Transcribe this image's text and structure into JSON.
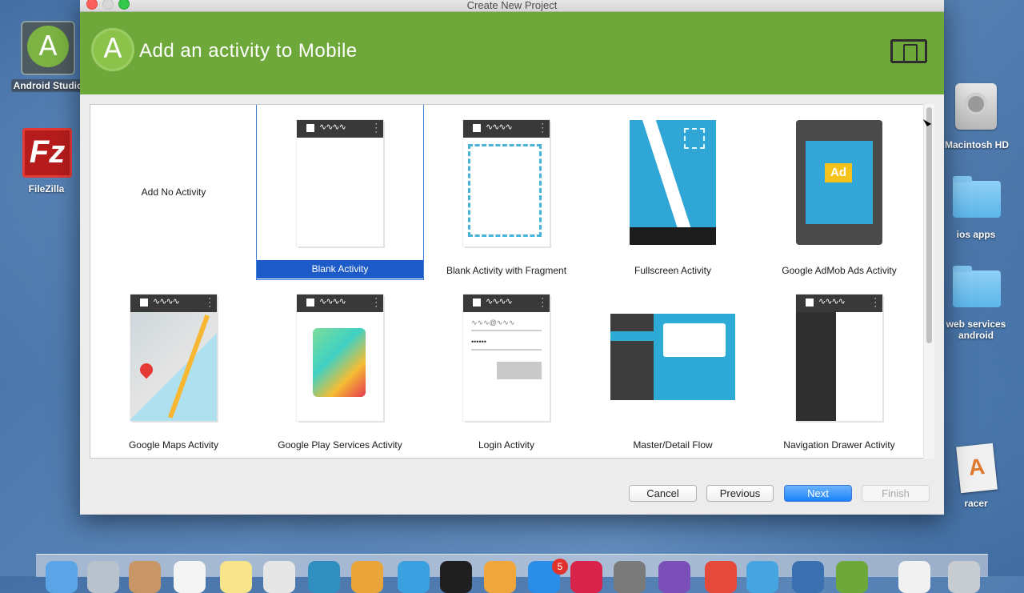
{
  "window": {
    "title": "Create New Project"
  },
  "header": {
    "title": "Add an activity to Mobile",
    "form_factor_icon": "devices-icon",
    "bg_color": "#6ea73a"
  },
  "desktop": {
    "left_icons": [
      {
        "label": "Android Studio",
        "icon": "android-studio-icon"
      },
      {
        "label": "FileZilla",
        "icon": "filezilla-icon"
      }
    ],
    "right_icons": [
      {
        "label": "Macintosh HD",
        "icon": "hard-drive-icon"
      },
      {
        "label": "ios apps",
        "icon": "folder-icon"
      },
      {
        "label": "web services android",
        "icon": "folder-icon"
      },
      {
        "label": "racer",
        "icon": "document-icon"
      }
    ]
  },
  "activities": [
    {
      "label": "Add No Activity",
      "selected": false
    },
    {
      "label": "Blank Activity",
      "selected": true
    },
    {
      "label": "Blank Activity with Fragment",
      "selected": false
    },
    {
      "label": "Fullscreen Activity",
      "selected": false
    },
    {
      "label": "Google AdMob Ads Activity",
      "selected": false,
      "ad_text": "Ad"
    },
    {
      "label": "Google Maps Activity",
      "selected": false
    },
    {
      "label": "Google Play Services Activity",
      "selected": false
    },
    {
      "label": "Login Activity",
      "selected": false,
      "email_hint": "∿∿∿@∿∿∿",
      "password_hint": "••••••"
    },
    {
      "label": "Master/Detail Flow",
      "selected": false
    },
    {
      "label": "Navigation Drawer Activity",
      "selected": false
    }
  ],
  "buttons": {
    "cancel": "Cancel",
    "previous": "Previous",
    "next": "Next",
    "finish": "Finish"
  },
  "dock": {
    "badge_count": "5"
  },
  "colors": {
    "selection": "#1d5bc8",
    "accent_blue": "#2eaad6",
    "android_green": "#6ea73a"
  }
}
